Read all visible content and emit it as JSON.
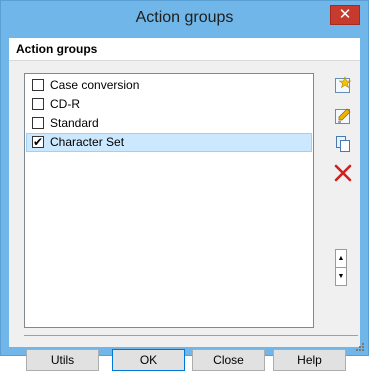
{
  "window": {
    "title": "Action groups",
    "close_glyph": "✕"
  },
  "header": {
    "title": "Action groups"
  },
  "list": {
    "items": [
      {
        "label": "Case conversion",
        "checked": false
      },
      {
        "label": "CD-R",
        "checked": false
      },
      {
        "label": "Standard",
        "checked": false
      },
      {
        "label": "Character Set",
        "checked": true,
        "selected": true
      }
    ]
  },
  "side_buttons": [
    {
      "name": "new-group-button",
      "icon": "new-star-icon"
    },
    {
      "name": "edit-group-button",
      "icon": "edit-pencil-icon"
    },
    {
      "name": "copy-group-button",
      "icon": "copy-icon"
    },
    {
      "name": "delete-group-button",
      "icon": "delete-x-icon"
    }
  ],
  "spin": {
    "up": "▲",
    "down": "▼"
  },
  "buttons": {
    "utils": "Utils",
    "ok": "OK",
    "close": "Close",
    "help": "Help"
  },
  "colors": {
    "titlebar": "#70b6e8",
    "close": "#c73b2f",
    "selection": "#cce8ff",
    "delete_red": "#d21f1f"
  }
}
